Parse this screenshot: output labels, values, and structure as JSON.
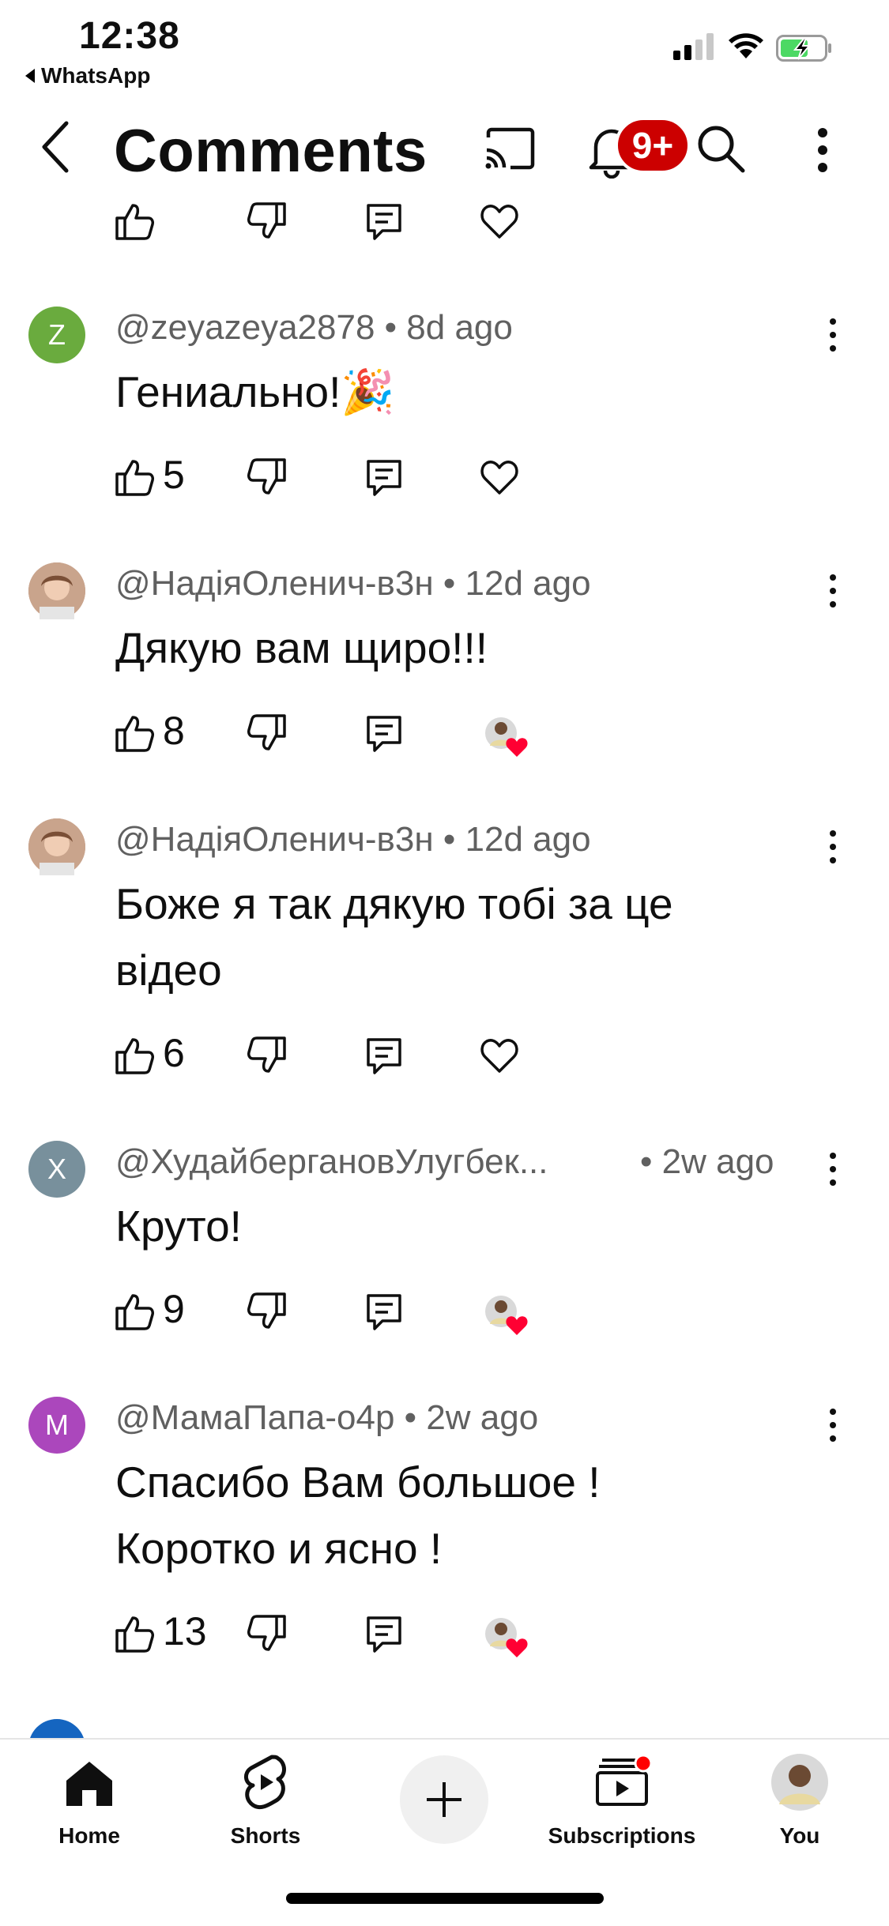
{
  "status_bar": {
    "time": "12:38",
    "back_app": "WhatsApp"
  },
  "header": {
    "title": "Comments",
    "notification_badge": "9+"
  },
  "comments": [
    {
      "author": "@zeyazeya2878 • 8d ago",
      "avatar_letter": "Z",
      "avatar_color": "#6aab3e",
      "text": "Гениально!🎉",
      "likes": "5",
      "creator_heart": false
    },
    {
      "author": "@НадіяОленич-в3н • 12d ago",
      "avatar_letter": "",
      "avatar_color": "#b98a74",
      "text": "Дякую вам щиро!!!",
      "likes": "8",
      "creator_heart": true
    },
    {
      "author": "@НадіяОленич-в3н • 12d ago",
      "avatar_letter": "",
      "avatar_color": "#b98a74",
      "text_line1": "Боже я так дякую тобі за це",
      "text_line2": "відео",
      "likes": "6",
      "creator_heart": false
    },
    {
      "author": "@ХудайбергановУлугбек...",
      "time": "• 2w ago",
      "avatar_letter": "X",
      "avatar_color": "#78909c",
      "text": "Круто!",
      "likes": "9",
      "creator_heart": true
    },
    {
      "author": "@МамаПапа-о4р • 2w ago",
      "avatar_letter": "M",
      "avatar_color": "#ab47bc",
      "text_line1": "Спасибо Вам большое !",
      "text_line2": "Коротко  и ясно !",
      "likes": "13",
      "creator_heart": true
    }
  ],
  "bottom_nav": {
    "home": "Home",
    "shorts": "Shorts",
    "subscriptions": "Subscriptions",
    "you": "You"
  }
}
